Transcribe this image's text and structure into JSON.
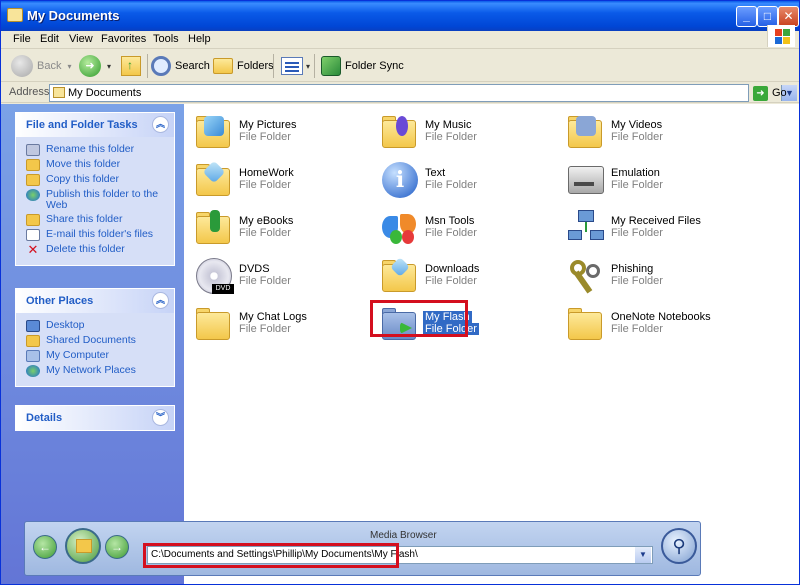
{
  "window": {
    "title": "My Documents"
  },
  "menu": [
    "File",
    "Edit",
    "View",
    "Favorites",
    "Tools",
    "Help"
  ],
  "toolbar": {
    "back": "Back",
    "search": "Search",
    "folders": "Folders",
    "folder_sync": "Folder Sync"
  },
  "address": {
    "label": "Address",
    "value": "My Documents",
    "go": "Go"
  },
  "file_tasks": {
    "title": "File and Folder Tasks",
    "items": [
      "Rename this folder",
      "Move this folder",
      "Copy this folder",
      "Publish this folder to the Web",
      "Share this folder",
      "E-mail this folder's files",
      "Delete this folder"
    ]
  },
  "other_places": {
    "title": "Other Places",
    "items": [
      "Desktop",
      "Shared Documents",
      "My Computer",
      "My Network Places"
    ]
  },
  "details": {
    "title": "Details"
  },
  "files": [
    {
      "name": "My Pictures",
      "type": "File Folder",
      "icon": "pictures-folder-icon"
    },
    {
      "name": "My Music",
      "type": "File Folder",
      "icon": "music-folder-icon"
    },
    {
      "name": "My Videos",
      "type": "File Folder",
      "icon": "videos-folder-icon"
    },
    {
      "name": "HomeWork",
      "type": "File Folder",
      "icon": "homework-folder-icon"
    },
    {
      "name": "Text",
      "type": "File Folder",
      "icon": "info-icon"
    },
    {
      "name": "Emulation",
      "type": "File Folder",
      "icon": "drive-icon"
    },
    {
      "name": "My eBooks",
      "type": "File Folder",
      "icon": "ebooks-folder-icon"
    },
    {
      "name": "Msn Tools",
      "type": "File Folder",
      "icon": "msn-butterfly-icon"
    },
    {
      "name": "My Received Files",
      "type": "File Folder",
      "icon": "network-icon"
    },
    {
      "name": "DVDS",
      "type": "File Folder",
      "icon": "dvd-icon"
    },
    {
      "name": "Downloads",
      "type": "File Folder",
      "icon": "downloads-folder-icon"
    },
    {
      "name": "Phishing",
      "type": "File Folder",
      "icon": "keys-icon"
    },
    {
      "name": "My Chat Logs",
      "type": "File Folder",
      "icon": "folder-icon"
    },
    {
      "name": "My Flash",
      "type": "File Folder",
      "icon": "flash-folder-icon",
      "selected": true
    },
    {
      "name": "OneNote Notebooks",
      "type": "File Folder",
      "icon": "folder-icon"
    }
  ],
  "media_browser": {
    "title": "Media Browser",
    "path": "C:\\Documents and Settings\\Phillip\\My Documents\\My Flash\\"
  }
}
